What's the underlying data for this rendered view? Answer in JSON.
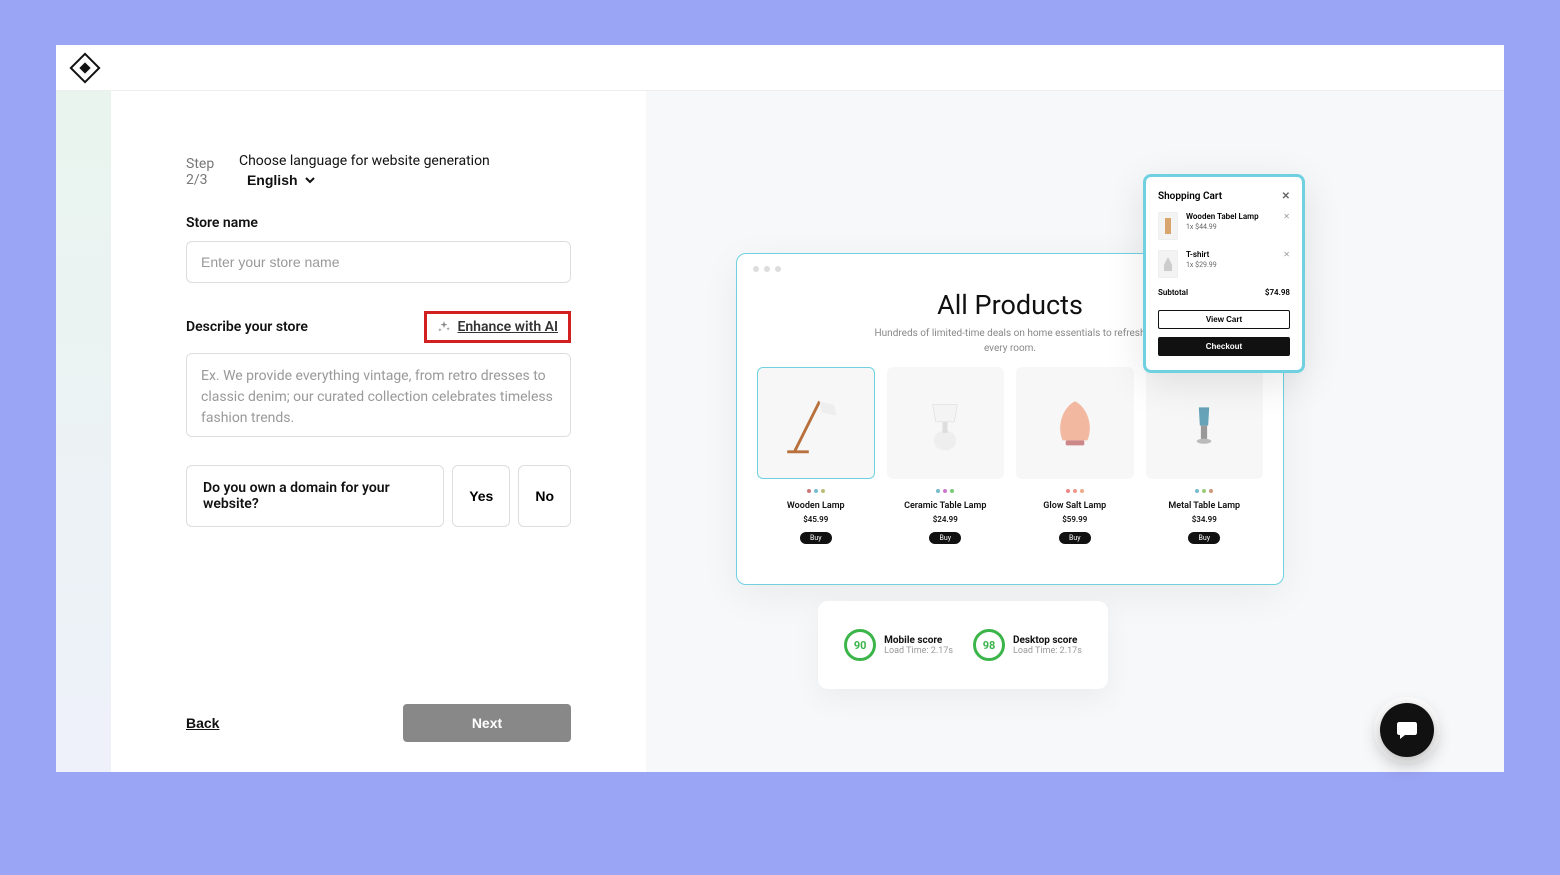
{
  "step": "Step 2/3",
  "language_label": "Choose language for website generation",
  "language_value": "English",
  "store_name_label": "Store name",
  "store_name_placeholder": "Enter your store name",
  "describe_label": "Describe your store",
  "enhance_label": "Enhance with AI",
  "describe_placeholder": "Ex. We provide everything vintage, from retro dresses to classic denim; our curated collection celebrates timeless fashion trends.",
  "domain_question": "Do you own a domain for your website?",
  "yes": "Yes",
  "no": "No",
  "back": "Back",
  "next": "Next",
  "preview": {
    "title": "All Products",
    "subtitle": "Hundreds of limited-time deals on home essentials to refresh every room.",
    "products": [
      {
        "name": "Wooden Lamp",
        "price": "$45.99",
        "buy": "Buy"
      },
      {
        "name": "Ceramic Table Lamp",
        "price": "$24.99",
        "buy": "Buy"
      },
      {
        "name": "Glow Salt Lamp",
        "price": "$59.99",
        "buy": "Buy"
      },
      {
        "name": "Metal Table Lamp",
        "price": "$34.99",
        "buy": "Buy"
      }
    ]
  },
  "cart": {
    "title": "Shopping Cart",
    "items": [
      {
        "name": "Wooden Tabel Lamp",
        "price": "1x $44.99"
      },
      {
        "name": "T-shirt",
        "price": "1x $29.99"
      }
    ],
    "subtotal_label": "Subtotal",
    "subtotal_value": "$74.98",
    "view_cart": "View Cart",
    "checkout": "Checkout"
  },
  "scores": {
    "mobile_value": "90",
    "mobile_title": "Mobile score",
    "mobile_sub": "Load Time: 2.17s",
    "desktop_value": "98",
    "desktop_title": "Desktop score",
    "desktop_sub": "Load Time: 2.17s"
  }
}
